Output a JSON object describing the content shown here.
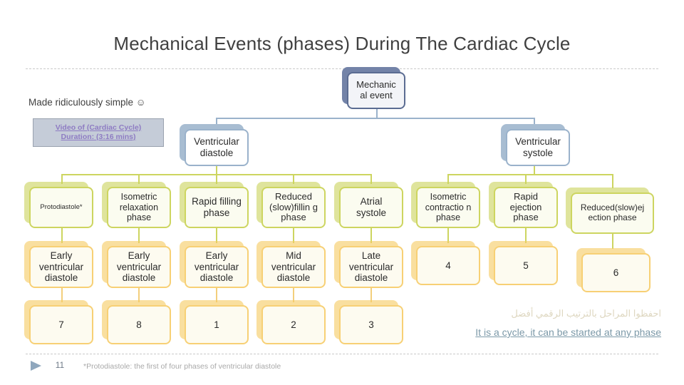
{
  "slide": {
    "title": "Mechanical Events (phases) During The Cardiac Cycle",
    "made_simple": "Made ridiculously simple ☺",
    "video_link": {
      "line1": "Video of (Cardiac Cycle)",
      "line2": "Duration: (3:16 mins)"
    },
    "arabic_note": "احفظوا المراحل بالترتيب الرقمي أفضل",
    "cycle_note": "It is a cycle, it can be started at any phase",
    "footer": {
      "slide_number": "11",
      "footnote": "*Protodiastole: the first of four phases of ventricular diastole",
      "play_icon": "play-triangle-icon"
    }
  },
  "diagram": {
    "root": {
      "label": "Mechanic al event"
    },
    "level2": [
      {
        "label": "Ventricular diastole"
      },
      {
        "label": "Ventricular systole"
      }
    ],
    "level3": [
      {
        "label": "Protodiastole*"
      },
      {
        "label": "Isometric relaxation phase"
      },
      {
        "label": "Rapid filling phase"
      },
      {
        "label": "Reduced (slow)fillin g phase"
      },
      {
        "label": "Atrial systole"
      },
      {
        "label": "Isometric contractio n phase"
      },
      {
        "label": "Rapid ejection phase"
      },
      {
        "label": "Reduced(slow)ej ection phase"
      }
    ],
    "level4": [
      {
        "label": "Early ventricular diastole"
      },
      {
        "label": "Early ventricular diastole"
      },
      {
        "label": "Early ventricular diastole"
      },
      {
        "label": "Mid ventricular diastole"
      },
      {
        "label": "Late ventricular diastole"
      },
      {
        "label": "4"
      },
      {
        "label": "5"
      },
      {
        "label": "6"
      }
    ],
    "level5": [
      {
        "label": "7"
      },
      {
        "label": "8"
      },
      {
        "label": "1"
      },
      {
        "label": "2"
      },
      {
        "label": "3"
      }
    ]
  },
  "colors": {
    "title_text": "#404040",
    "blue_root_border": "#5b6c92",
    "blue_branch_border": "#9ab2cb",
    "olive_border": "#cdd560",
    "amber_border": "#f7d075",
    "video_link_text": "#8e7cc3",
    "video_box_bg": "#c5ccd8",
    "cycle_note_text": "#7c99a8",
    "arabic_text": "#ded7c0"
  }
}
